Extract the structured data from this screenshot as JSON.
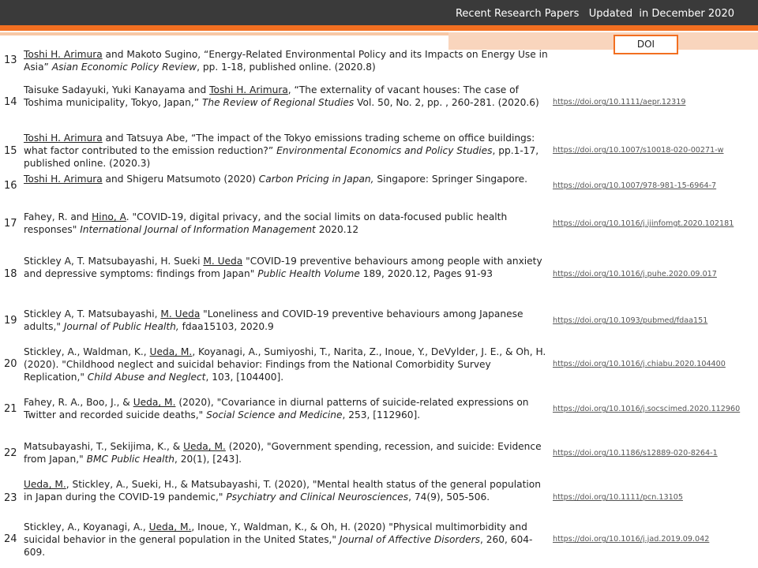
{
  "header": {
    "title": "Recent Research Papers   Updated  in December 2020",
    "doi_label": "DOI"
  },
  "entries": [
    {
      "num": "13",
      "parts": [
        "",
        "Toshi H. Arimura",
        " and Makoto Sugino, “Energy-Related Environmental Policy and its Impacts on Energy Use in Asia” ",
        "Asian Economic Policy Review",
        ", pp. 1-18, published online. (2020.8)"
      ],
      "doi": ""
    },
    {
      "num": "14",
      "parts": [
        "Taisuke Sadayuki, Yuki Kanayama and ",
        "Toshi H. Arimura",
        ", “The externality of vacant houses:  The case of Toshima  municipality, Tokyo, Japan,” ",
        "The Review of Regional Studies",
        " Vol. 50, No. 2, pp. , 260-281.         (2020.6)"
      ],
      "doi": "https://doi.org/10.1111/aepr.12319"
    },
    {
      "num": "15",
      "parts": [
        "",
        "Toshi H. Arimura",
        " and Tatsuya Abe,  “The impact of the Tokyo emissions  trading scheme on office buildings:  what factor contributed to the emission  reduction?” ",
        "Environmental  Economics and Policy Studies",
        ", pp.1-17, published online. (2020.3)"
      ],
      "doi": "https://doi.org/10.1007/s10018-020-00271-w"
    },
    {
      "num": "16",
      "parts": [
        "",
        "Toshi H. Arimura",
        " and Shigeru Matsumoto (2020) ",
        "Carbon Pricing in Japan,",
        " Singapore: Springer Singapore."
      ],
      "doi": "https://doi.org/10.1007/978-981-15-6964-7"
    },
    {
      "num": "17",
      "parts": [
        "Fahey, R. and ",
        "Hino, A",
        ". \"COVID-19, digital privacy, and the social limits on data-focused public health responses\" ",
        "International Journal of Information Management",
        "  2020.12"
      ],
      "doi": "https://doi.org/10.1016/j.ijinfomgt.2020.102181"
    },
    {
      "num": "18",
      "parts": [
        "Stickley A, T. Matsubayashi, H. Sueki  ",
        "M. Ueda",
        "  \"COVID-19 preventive behaviours among people with anxiety and depressive symptoms:  findings from Japan\" ",
        "Public Health Volume",
        " 189,  2020.12, Pages 91-93"
      ],
      "doi": "https://doi.org/10.1016/j.puhe.2020.09.017"
    },
    {
      "num": "19",
      "parts": [
        "Stickley A, T. Matsubayashi, ",
        "M. Ueda",
        "   \"Loneliness and COVID-19 preventive behaviours among Japanese adults,\" ",
        "Journal of Public Health,",
        " fdaa15103, 2020.9"
      ],
      "doi": "https://doi.org/10.1093/pubmed/fdaa151"
    },
    {
      "num": "20",
      "parts": [
        "Stickley, A., Waldman, K., ",
        "Ueda, M.",
        ", Koyanagi, A., Sumiyoshi,  T., Narita, Z., Inoue, Y., DeVylder, J. E., & Oh, H. (2020). \"Childhood neglect and suicidal behavior: Findings from the National Comorbidity Survey Replication,\" ",
        "Child Abuse and Neglect",
        ", 103, [104400]."
      ],
      "doi": "https://doi.org/10.1016/j.chiabu.2020.104400"
    },
    {
      "num": "21",
      "parts": [
        "Fahey, R. A., Boo, J., & ",
        "Ueda, M.",
        " (2020), \"Covariance in diurnal patterns of suicide-related expressions on Twitter and recorded suicide deaths,\" ",
        "Social Science and Medicine",
        ", 253, [112960]."
      ],
      "doi": "https://doi.org/10.1016/j.socscimed.2020.112960"
    },
    {
      "num": "22",
      "parts": [
        "Matsubayashi, T., Sekijima, K., & ",
        "Ueda, M.",
        " (2020), \"Government spending, recession, and suicide: Evidence from Japan,\" ",
        "BMC Public Health",
        ", 20(1), [243]."
      ],
      "doi": "https://doi.org/10.1186/s12889-020-8264-1"
    },
    {
      "num": "23",
      "parts": [
        "",
        "Ueda, M.",
        ", Stickley, A., Sueki, H., & Matsubayashi, T. (2020), \"Mental health status of the general population in Japan during the COVID-19 pandemic,\" ",
        "Psychiatry and Clinical Neurosciences",
        ", 74(9), 505-506."
      ],
      "doi": "https://doi.org/10.1111/pcn.13105"
    },
    {
      "num": "24",
      "parts": [
        "Stickley, A., Koyanagi, A., ",
        "Ueda, M.",
        ", Inoue, Y., Waldman, K., & Oh, H. (2020) \"Physical multimorbidity  and suicidal behavior in the general population in the United States,\" ",
        "Journal of Affective Disorders",
        ",  260, 604-609."
      ],
      "doi": "https://doi.org/10.1016/j.jad.2019.09.042"
    }
  ]
}
